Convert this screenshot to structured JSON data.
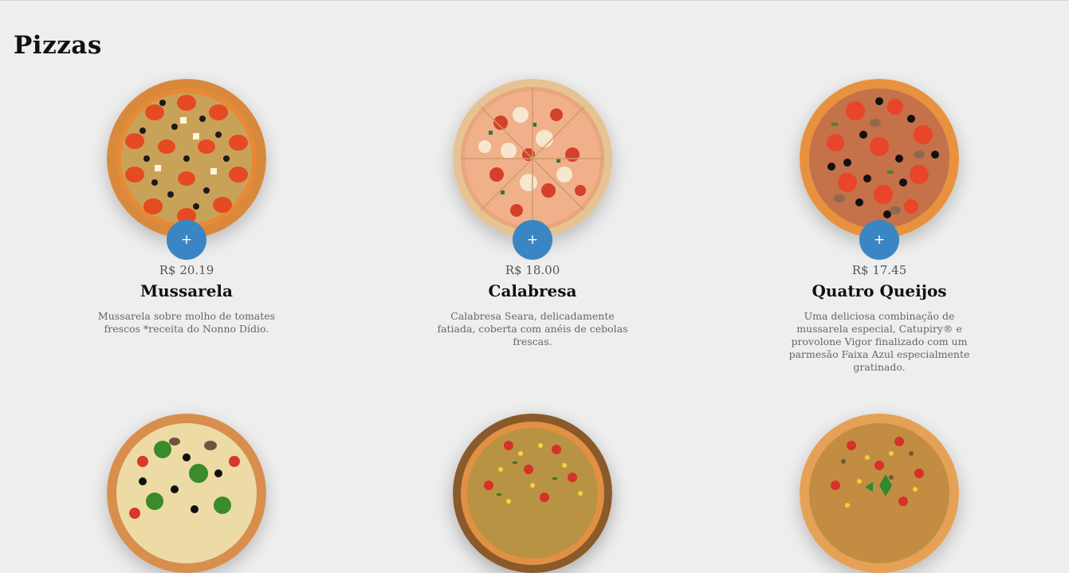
{
  "section": {
    "title": "Pizzas"
  },
  "products": [
    {
      "name": "Mussarela",
      "price": "R$ 20.19",
      "description": "Mussarela sobre molho de tomates frescos *receita do Nonno Dídio.",
      "add_label": "+"
    },
    {
      "name": "Calabresa",
      "price": "R$ 18.00",
      "description": "Calabresa Seara, delicadamente fatiada, coberta com anéis de cebolas frescas.",
      "add_label": "+"
    },
    {
      "name": "Quatro Queijos",
      "price": "R$ 17.45",
      "description": "Uma deliciosa combinação de mussarela especial, Catupiry® e provolone Vigor finalizado com um parmesão Faixa Azul especialmente gratinado.",
      "add_label": "+"
    }
  ],
  "colors": {
    "background": "#eeeeee",
    "add_button": "#3a86c4",
    "crust": "#d9893c",
    "sauce": "#e0522a",
    "cheese": "#f3d07a",
    "olive": "#1a1a1a",
    "pepper": "#d62b1f",
    "green": "#3d8a2f",
    "wood_board": "#8b5a2b"
  },
  "icons": {
    "add": "plus-icon"
  }
}
